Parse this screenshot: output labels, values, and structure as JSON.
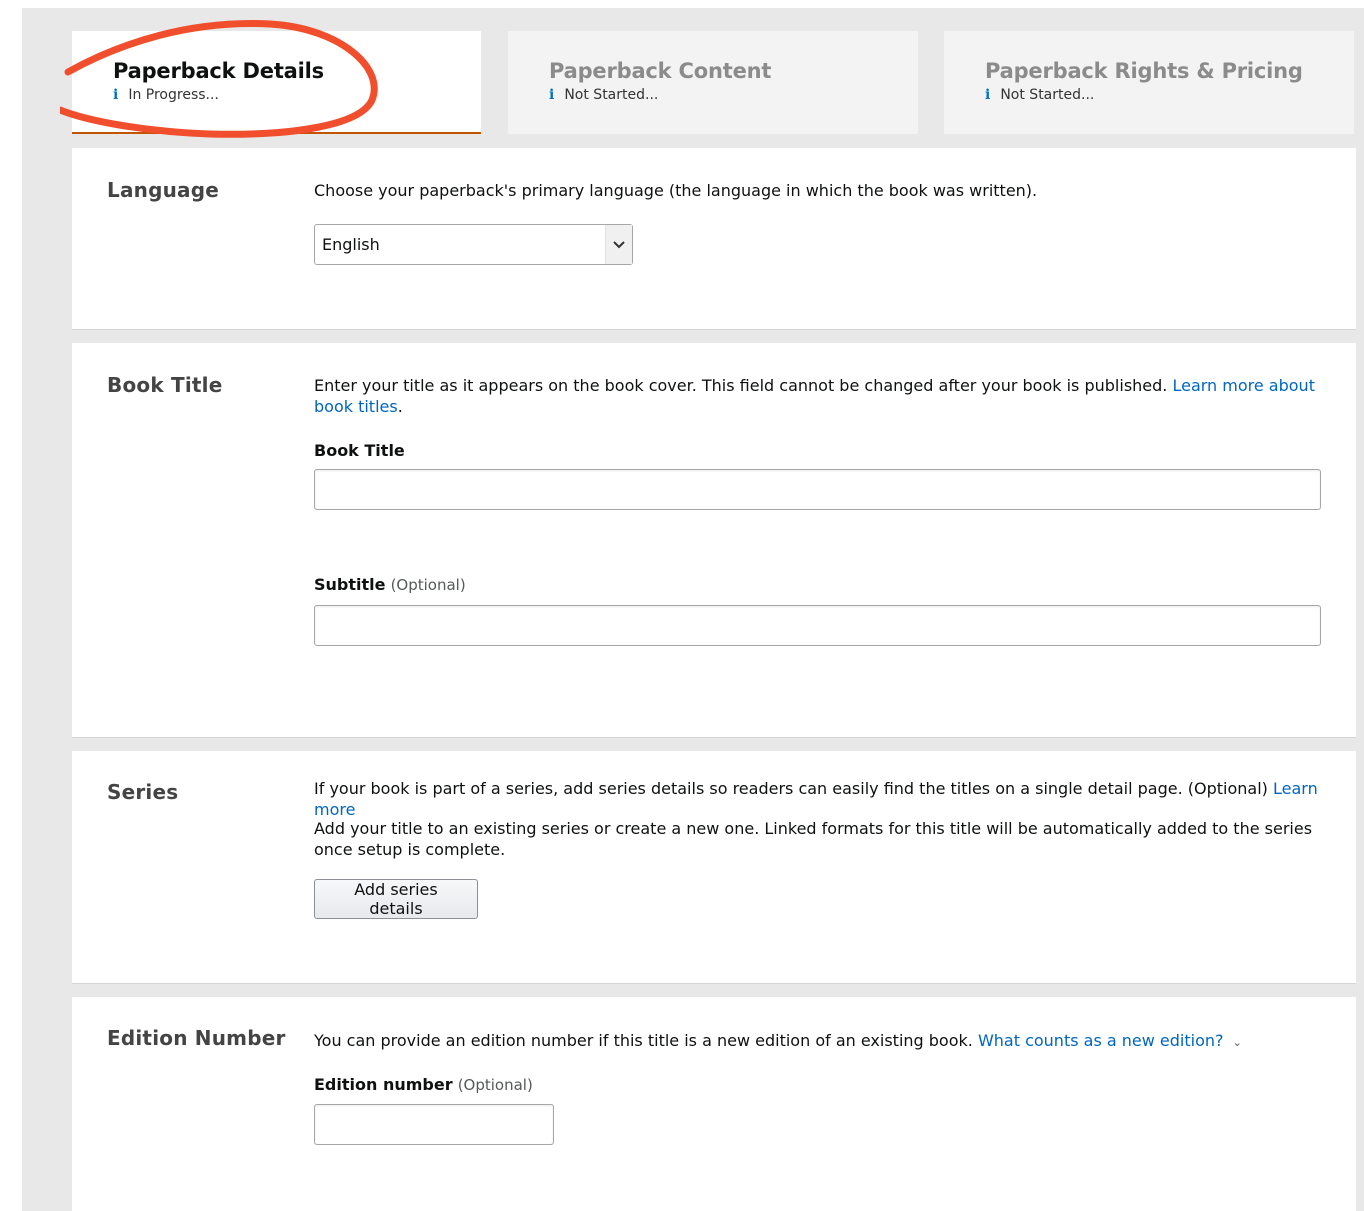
{
  "tabs": [
    {
      "title": "Paperback Details",
      "status": "In Progress...",
      "active": true
    },
    {
      "title": "Paperback Content",
      "status": "Not Started...",
      "active": false
    },
    {
      "title": "Paperback Rights & Pricing",
      "status": "Not Started...",
      "active": false
    }
  ],
  "info_icon": "i",
  "annotation_color": "#f04e2d",
  "language": {
    "heading": "Language",
    "description": "Choose your paperback's primary language (the language in which the book was written).",
    "selected": "English"
  },
  "book_title": {
    "heading": "Book Title",
    "description": "Enter your title as it appears on the book cover. This field cannot be changed after your book is published.",
    "link": "Learn more about book titles",
    "description_end": ".",
    "title_label": "Book Title",
    "title_value": "",
    "subtitle_label": "Subtitle",
    "subtitle_optional": "(Optional)",
    "subtitle_value": ""
  },
  "series": {
    "heading": "Series",
    "description": "If your book is part of a series, add series details so readers can easily find the titles on a single detail page. (Optional)",
    "link": "Learn more",
    "text2": "Add your title to an existing series or create a new one. Linked formats for this title will be automatically added to the series once setup is complete.",
    "button": "Add series details"
  },
  "edition": {
    "heading": "Edition Number",
    "description": "You can provide an edition number if this title is a new edition of an existing book.",
    "link": "What counts as a new edition?",
    "label": "Edition number",
    "optional": "(Optional)",
    "value": ""
  }
}
